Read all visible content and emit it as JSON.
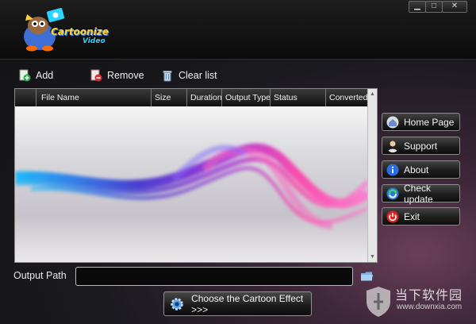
{
  "logo": {
    "line1": "Cartoonize",
    "line2": "Video"
  },
  "window_controls": {
    "minimize": "▁",
    "maximize": "□",
    "close": "✕"
  },
  "toolbar": {
    "add": "Add",
    "remove": "Remove",
    "clear": "Clear list"
  },
  "table": {
    "columns": [
      "File Name",
      "Size",
      "Duration",
      "Output Type",
      "Status",
      "Converted"
    ]
  },
  "side_buttons": [
    {
      "label": "Home Page",
      "icon": "home-icon"
    },
    {
      "label": "Support",
      "icon": "support-person-icon"
    },
    {
      "label": "About",
      "icon": "info-icon"
    },
    {
      "label": "Check update",
      "icon": "refresh-icon"
    },
    {
      "label": "Exit",
      "icon": "power-icon"
    }
  ],
  "output": {
    "label": "Output Path",
    "value": ""
  },
  "convert_button": {
    "label": "Choose the Cartoon Effect >>>"
  },
  "watermark": {
    "cn": "当下软件园",
    "url": "www.downxia.com"
  },
  "colors": {
    "accent_cyan": "#2ad6ff",
    "accent_pink": "#ff3ea8",
    "logo_yellow": "#ffd23a",
    "logo_blue": "#3a8cff"
  }
}
